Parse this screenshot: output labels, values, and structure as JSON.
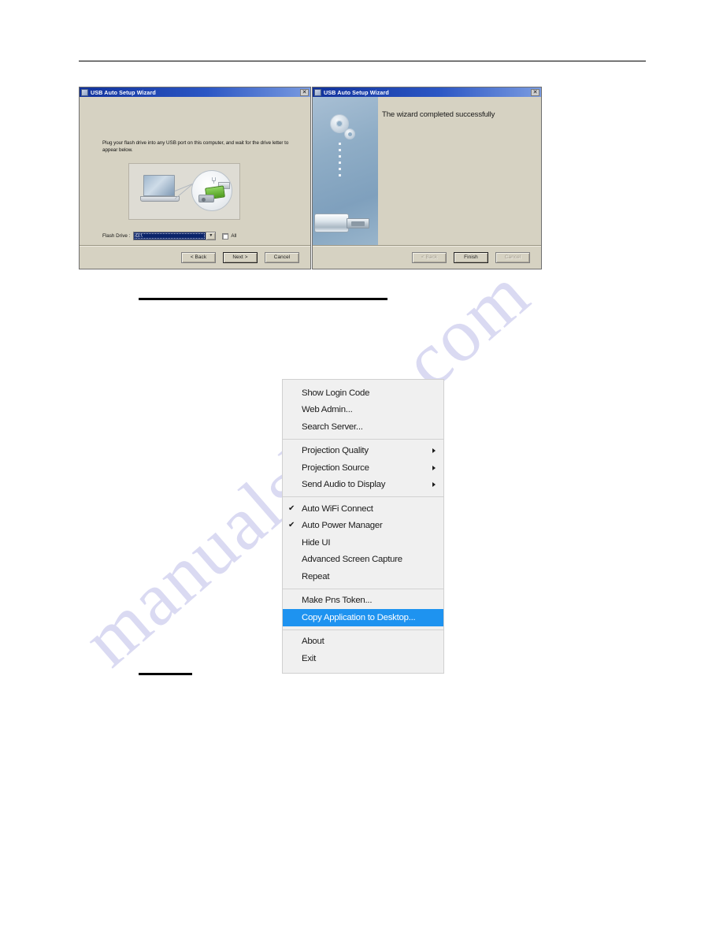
{
  "dialog_one": {
    "title": "USB Auto Setup Wizard",
    "close_label": "✕",
    "instruction": "Plug your flash drive into any USB port on this computer, and wait for the drive letter to appear below.",
    "field_label": "Flash Drive :",
    "drive_value": "G:\\",
    "dropdown_arrow": "▼",
    "all_checkbox_label": "All",
    "buttons": {
      "back": "< Back",
      "next": "Next >",
      "cancel": "Cancel"
    },
    "illustration": {
      "laptop": "laptop-icon",
      "magnifier": "magnifier-icon",
      "usb_symbol": "⑂",
      "green_drive": "usb-flash-drive-icon"
    }
  },
  "dialog_two": {
    "title": "USB Auto Setup Wizard",
    "close_label": "✕",
    "heading": "The wizard completed successfully",
    "buttons": {
      "back": "< Back",
      "finish": "Finish",
      "cancel": "Cancel"
    },
    "sidepanel": {
      "gear_large": "gear-icon",
      "gear_small": "gear-small-icon",
      "usb_stick": "usb-flash-drive-icon"
    }
  },
  "context_menu": {
    "highlight_color": "#1e93f0",
    "groups": [
      {
        "items": [
          {
            "label": "Show Login Code",
            "checked": false,
            "submenu": false,
            "selected": false
          },
          {
            "label": "Web Admin...",
            "checked": false,
            "submenu": false,
            "selected": false
          },
          {
            "label": "Search Server...",
            "checked": false,
            "submenu": false,
            "selected": false
          }
        ]
      },
      {
        "items": [
          {
            "label": "Projection Quality",
            "checked": false,
            "submenu": true,
            "selected": false
          },
          {
            "label": "Projection Source",
            "checked": false,
            "submenu": true,
            "selected": false
          },
          {
            "label": "Send Audio to Display",
            "checked": false,
            "submenu": true,
            "selected": false
          }
        ]
      },
      {
        "items": [
          {
            "label": "Auto WiFi Connect",
            "checked": true,
            "submenu": false,
            "selected": false
          },
          {
            "label": "Auto Power Manager",
            "checked": true,
            "submenu": false,
            "selected": false
          },
          {
            "label": "Hide UI",
            "checked": false,
            "submenu": false,
            "selected": false
          },
          {
            "label": "Advanced Screen Capture",
            "checked": false,
            "submenu": false,
            "selected": false
          },
          {
            "label": "Repeat",
            "checked": false,
            "submenu": false,
            "selected": false
          }
        ]
      },
      {
        "items": [
          {
            "label": "Make Pns Token...",
            "checked": false,
            "submenu": false,
            "selected": false
          },
          {
            "label": "Copy Application to Desktop...",
            "checked": false,
            "submenu": false,
            "selected": true
          }
        ]
      },
      {
        "items": [
          {
            "label": "About",
            "checked": false,
            "submenu": false,
            "selected": false
          },
          {
            "label": "Exit",
            "checked": false,
            "submenu": false,
            "selected": false
          }
        ]
      }
    ],
    "check_glyph": "✔"
  },
  "watermark": {
    "text": "manualshive.com",
    "color": "#d9d9f2"
  }
}
